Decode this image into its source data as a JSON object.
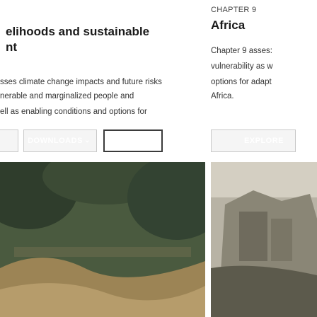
{
  "left_card": {
    "title_line1": "elihoods and sustainable",
    "title_line2": "nt",
    "description_lines": [
      "sses climate change impacts and future risks",
      "nerable and marginalized people and",
      "ell as enabling conditions and options for"
    ],
    "buttons": {
      "downloads_label": "DOWNLOADS",
      "downloads_chevron": "⌄",
      "figures_label": "FIGURES"
    },
    "image_icon": "photo-image"
  },
  "right_card": {
    "chapter_label": "CHAPTER 9",
    "title": "Africa",
    "description_lines": [
      "Chapter 9 asses:",
      "vulnerability as w",
      "options for adapt",
      "Africa."
    ],
    "buttons": {
      "explore_label": "EXPLORE"
    },
    "image_icon": "photo-image"
  },
  "colors": {
    "button_bg": "#f5f5f5",
    "button_border": "#c9c9c9",
    "figures_border": "#3b3b3b",
    "title_text": "#1a1a1a"
  }
}
